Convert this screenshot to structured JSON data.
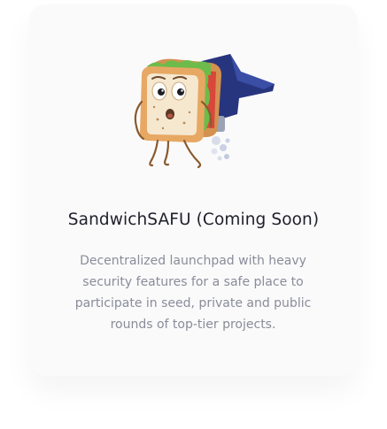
{
  "card": {
    "title": "SandwichSAFU (Coming Soon)",
    "description": "Decentralized launchpad with heavy security features for a safe place to participate in seed, private and public rounds of top-tier projects.",
    "illustration_icon": "sandwich-mascot-jetpack-icon"
  },
  "colors": {
    "title": "#1f1f2b",
    "description": "#8a8c99",
    "card_background": "#fafafb",
    "jetpack": "#27357e",
    "bread": "#e7a864",
    "bread_face": "#f6e7cf",
    "lettuce": "#6dbb4b",
    "tomato": "#d9473b"
  }
}
